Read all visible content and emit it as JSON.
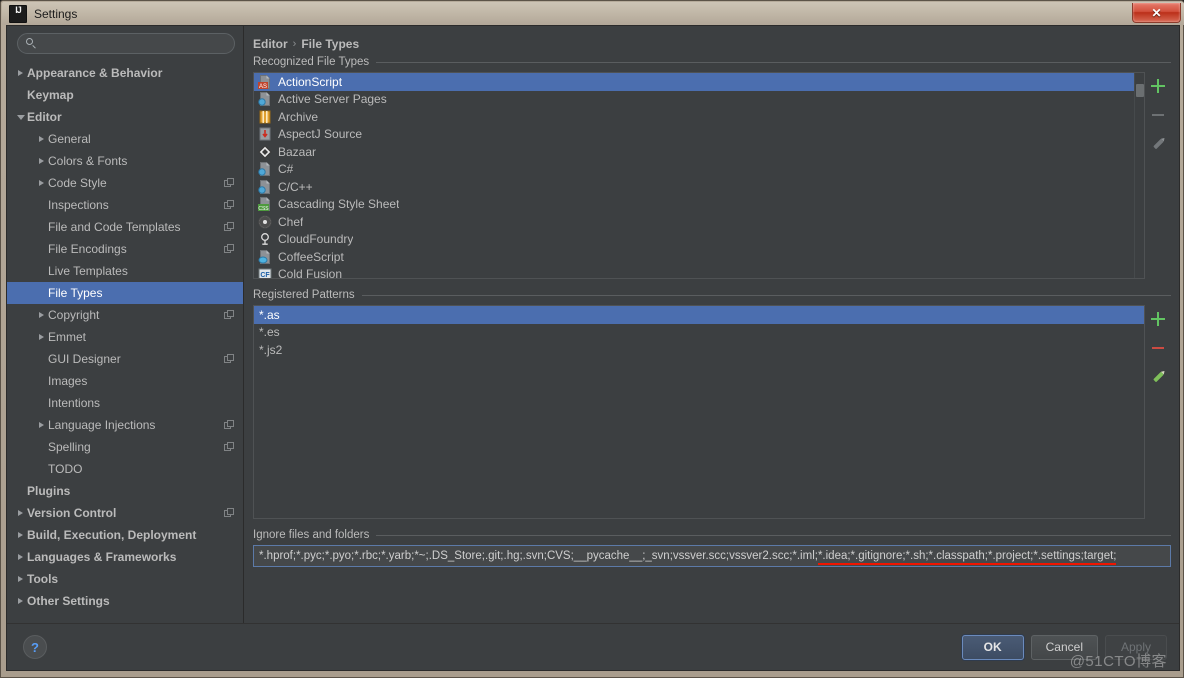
{
  "window": {
    "title": "Settings",
    "logo_icon": "intellij-idea-logo",
    "close_icon": "close-icon",
    "close_label": "✕"
  },
  "sidebar": {
    "search": {
      "value": "",
      "placeholder": "",
      "icon": "search-icon"
    },
    "items": [
      {
        "label": "Appearance & Behavior",
        "level": 0,
        "arrow": "right",
        "bold": true,
        "scope": false,
        "selected": false
      },
      {
        "label": "Keymap",
        "level": 0,
        "arrow": "none",
        "bold": true,
        "scope": false,
        "selected": false
      },
      {
        "label": "Editor",
        "level": 0,
        "arrow": "down",
        "bold": true,
        "scope": false,
        "selected": false
      },
      {
        "label": "General",
        "level": 1,
        "arrow": "right",
        "bold": false,
        "scope": false,
        "selected": false
      },
      {
        "label": "Colors & Fonts",
        "level": 1,
        "arrow": "right",
        "bold": false,
        "scope": false,
        "selected": false
      },
      {
        "label": "Code Style",
        "level": 1,
        "arrow": "right",
        "bold": false,
        "scope": true,
        "selected": false
      },
      {
        "label": "Inspections",
        "level": 1,
        "arrow": "none",
        "bold": false,
        "scope": true,
        "selected": false
      },
      {
        "label": "File and Code Templates",
        "level": 1,
        "arrow": "none",
        "bold": false,
        "scope": true,
        "selected": false
      },
      {
        "label": "File Encodings",
        "level": 1,
        "arrow": "none",
        "bold": false,
        "scope": true,
        "selected": false
      },
      {
        "label": "Live Templates",
        "level": 1,
        "arrow": "none",
        "bold": false,
        "scope": false,
        "selected": false
      },
      {
        "label": "File Types",
        "level": 1,
        "arrow": "none",
        "bold": false,
        "scope": false,
        "selected": true
      },
      {
        "label": "Copyright",
        "level": 1,
        "arrow": "right",
        "bold": false,
        "scope": true,
        "selected": false
      },
      {
        "label": "Emmet",
        "level": 1,
        "arrow": "right",
        "bold": false,
        "scope": false,
        "selected": false
      },
      {
        "label": "GUI Designer",
        "level": 1,
        "arrow": "none",
        "bold": false,
        "scope": true,
        "selected": false
      },
      {
        "label": "Images",
        "level": 1,
        "arrow": "none",
        "bold": false,
        "scope": false,
        "selected": false
      },
      {
        "label": "Intentions",
        "level": 1,
        "arrow": "none",
        "bold": false,
        "scope": false,
        "selected": false
      },
      {
        "label": "Language Injections",
        "level": 1,
        "arrow": "right",
        "bold": false,
        "scope": true,
        "selected": false
      },
      {
        "label": "Spelling",
        "level": 1,
        "arrow": "none",
        "bold": false,
        "scope": true,
        "selected": false
      },
      {
        "label": "TODO",
        "level": 1,
        "arrow": "none",
        "bold": false,
        "scope": false,
        "selected": false
      },
      {
        "label": "Plugins",
        "level": 0,
        "arrow": "none",
        "bold": true,
        "scope": false,
        "selected": false
      },
      {
        "label": "Version Control",
        "level": 0,
        "arrow": "right",
        "bold": true,
        "scope": true,
        "selected": false
      },
      {
        "label": "Build, Execution, Deployment",
        "level": 0,
        "arrow": "right",
        "bold": true,
        "scope": false,
        "selected": false
      },
      {
        "label": "Languages & Frameworks",
        "level": 0,
        "arrow": "right",
        "bold": true,
        "scope": false,
        "selected": false
      },
      {
        "label": "Tools",
        "level": 0,
        "arrow": "right",
        "bold": true,
        "scope": false,
        "selected": false
      },
      {
        "label": "Other Settings",
        "level": 0,
        "arrow": "right",
        "bold": true,
        "scope": false,
        "selected": false
      }
    ]
  },
  "breadcrumb": {
    "parent": "Editor",
    "separator": "›",
    "current": "File Types"
  },
  "file_types": {
    "section_label": "Recognized File Types",
    "toolbar": {
      "add_icon": "plus-icon",
      "remove_icon": "minus-icon",
      "edit_icon": "pencil-icon",
      "add_enabled": true,
      "remove_enabled": false,
      "edit_enabled": false
    },
    "rows": [
      {
        "label": "ActionScript",
        "icon": "actionscript-file-icon",
        "selected": true
      },
      {
        "label": "Active Server Pages",
        "icon": "asp-file-icon",
        "selected": false
      },
      {
        "label": "Archive",
        "icon": "archive-file-icon",
        "selected": false
      },
      {
        "label": "AspectJ Source",
        "icon": "aspectj-file-icon",
        "selected": false
      },
      {
        "label": "Bazaar",
        "icon": "bazaar-file-icon",
        "selected": false
      },
      {
        "label": "C#",
        "icon": "csharp-file-icon",
        "selected": false
      },
      {
        "label": "C/C++",
        "icon": "cpp-file-icon",
        "selected": false
      },
      {
        "label": "Cascading Style Sheet",
        "icon": "css-file-icon",
        "selected": false
      },
      {
        "label": "Chef",
        "icon": "chef-file-icon",
        "selected": false
      },
      {
        "label": "CloudFoundry",
        "icon": "cloudfoundry-file-icon",
        "selected": false
      },
      {
        "label": "CoffeeScript",
        "icon": "coffeescript-file-icon",
        "selected": false
      },
      {
        "label": "Cold Fusion",
        "icon": "coldfusion-file-icon",
        "selected": false
      }
    ]
  },
  "patterns": {
    "section_label": "Registered Patterns",
    "toolbar": {
      "add_icon": "plus-icon",
      "remove_icon": "minus-icon",
      "edit_icon": "pencil-icon",
      "add_enabled": true,
      "remove_enabled": true,
      "edit_enabled": true
    },
    "rows": [
      {
        "label": "*.as",
        "selected": true
      },
      {
        "label": "*.es",
        "selected": false
      },
      {
        "label": "*.js2",
        "selected": false
      }
    ]
  },
  "ignore": {
    "section_label": "Ignore files and folders",
    "value": "*.hprof;*.pyc;*.pyo;*.rbc;*.yarb;*~;.DS_Store;.git;.hg;.svn;CVS;__pycache__;_svn;vssver.scc;vssver2.scc;*.iml;*.idea;*.gitignore;*.sh;*.classpath;*.project;*.settings;target;",
    "highlight_color": "#f01500"
  },
  "footer": {
    "help_icon": "help-icon",
    "help_label": "?",
    "ok_label": "OK",
    "cancel_label": "Cancel",
    "apply_label": "Apply",
    "apply_enabled": false,
    "watermark": "@51CTO博客"
  },
  "colors": {
    "selection": "#4b6eaf",
    "panel_bg": "#3c3f41",
    "field_bg": "#45484a",
    "text": "#bbbbbb",
    "accent_green": "#62c462",
    "accent_red": "#cc4b42"
  }
}
